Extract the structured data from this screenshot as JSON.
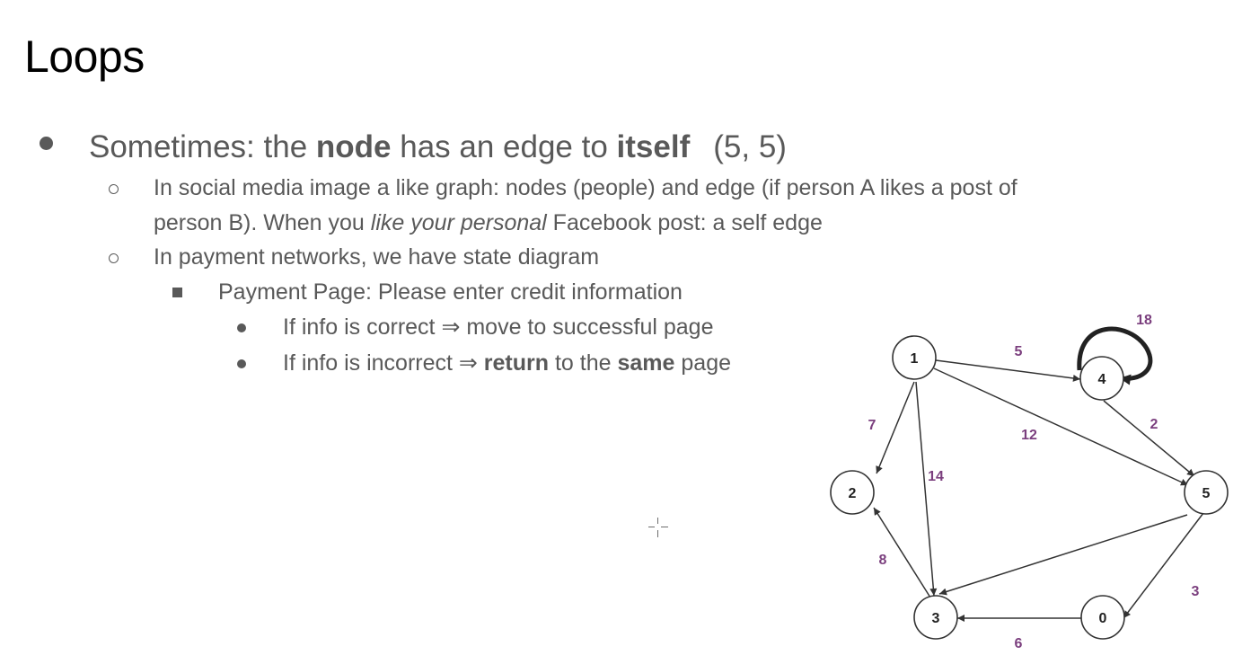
{
  "slide": {
    "title": "Loops",
    "bullet1": {
      "pre": "Sometimes: the ",
      "node": "node",
      "mid": " has an edge to ",
      "itself": "itself",
      "pair": "(5, 5)"
    },
    "sub1": {
      "line1": "In social media image a like graph: nodes (people) and edge (if person A likes a post of",
      "line2_pre": "person B). When you ",
      "line2_em": "like your personal",
      "line2_post": " Facebook post: a self edge"
    },
    "sub2": "In payment networks, we have state diagram",
    "sub3": "Payment Page: Please enter credit information",
    "sub4": "If info is correct ⇒ move to successful page",
    "sub5": {
      "pre": "If info is incorrect ⇒ ",
      "ret": "return",
      "mid": " to the ",
      "same": "same",
      "post": " page"
    }
  },
  "graph": {
    "nodes": [
      {
        "id": "n1",
        "label": "1"
      },
      {
        "id": "n4",
        "label": "4"
      },
      {
        "id": "n2",
        "label": "2"
      },
      {
        "id": "n5",
        "label": "5"
      },
      {
        "id": "n3",
        "label": "3"
      },
      {
        "id": "n0",
        "label": "0"
      }
    ],
    "edges": [
      {
        "from": "1",
        "to": "4",
        "weight": "5"
      },
      {
        "from": "4",
        "to": "4",
        "weight": "18"
      },
      {
        "from": "1",
        "to": "2",
        "weight": "7"
      },
      {
        "from": "1",
        "to": "5",
        "weight": "12"
      },
      {
        "from": "4",
        "to": "5",
        "weight": "2"
      },
      {
        "from": "1",
        "to": "3",
        "weight": "14"
      },
      {
        "from": "3",
        "to": "2",
        "weight": "8"
      },
      {
        "from": "5",
        "to": "3",
        "weight": ""
      },
      {
        "from": "5",
        "to": "0",
        "weight": "3"
      },
      {
        "from": "0",
        "to": "3",
        "weight": "6"
      }
    ],
    "edge_color": "#333333",
    "weight_color": "#7b3f7e"
  }
}
